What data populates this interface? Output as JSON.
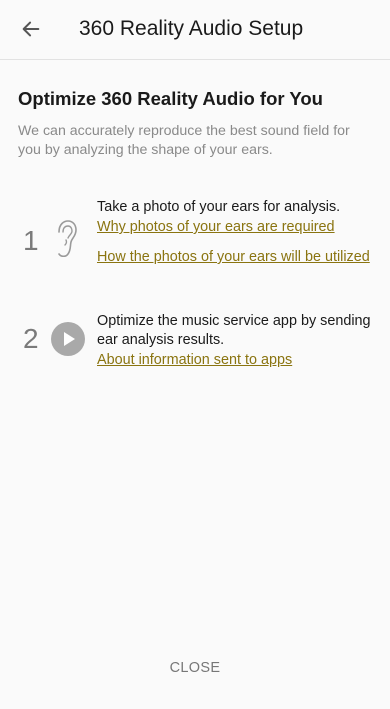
{
  "appbar": {
    "title": "360 Reality Audio Setup",
    "back_icon": "arrow-left-icon"
  },
  "main": {
    "heading": "Optimize 360 Reality Audio for You",
    "description": "We can accurately reproduce the best sound field for you by analyzing the shape of your ears."
  },
  "steps": [
    {
      "number": "1",
      "icon": "ear-icon",
      "text": "Take a photo of your ears for analysis.",
      "links": [
        "Why photos of your ears are required",
        "How the photos of your ears will be utilized"
      ]
    },
    {
      "number": "2",
      "icon": "play-icon",
      "text": "Optimize the music service app by sending ear analysis results.",
      "links": [
        "About information sent to apps"
      ]
    }
  ],
  "footer": {
    "close_label": "CLOSE"
  },
  "colors": {
    "link": "#8a7410",
    "background": "#fafafa",
    "muted_text": "#8a8a8a"
  }
}
